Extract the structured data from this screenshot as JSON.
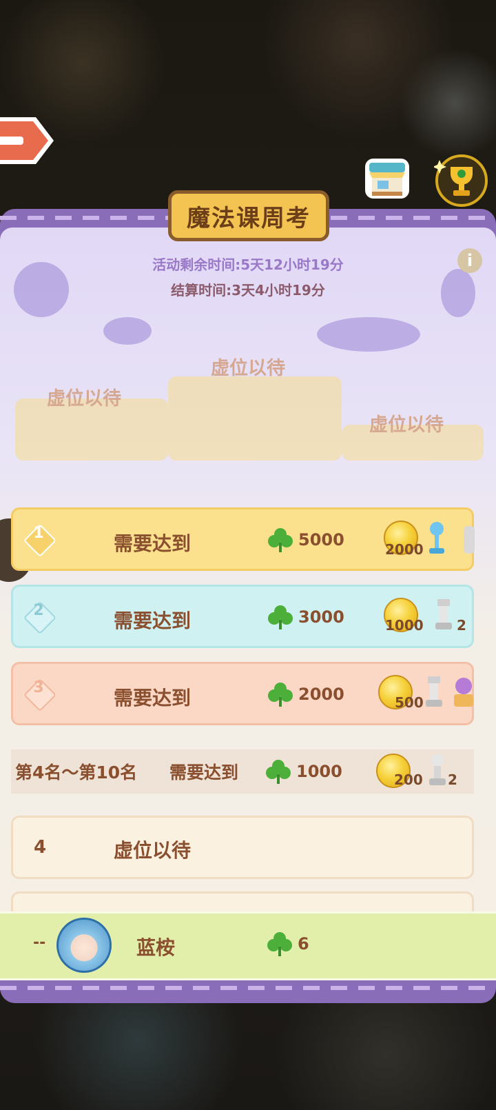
{
  "header": {
    "title": "魔法课周考",
    "remaining_time": "活动剩余时间:5天12小时19分",
    "settlement_time": "结算时间:3天4小时19分"
  },
  "icons": {
    "back": "back-arrow-icon",
    "shop": "shop-stall-icon",
    "trophy": "trophy-icon",
    "info": "info-icon",
    "clover": "clover-icon",
    "coin": "coin-icon"
  },
  "podium": {
    "first": "虚位以待",
    "second": "虚位以待",
    "third": "虚位以待"
  },
  "rewards": [
    {
      "rank": "1",
      "label": "需要达到",
      "score": "5000",
      "coins": "2000",
      "extra_count": ""
    },
    {
      "rank": "2",
      "label": "需要达到",
      "score": "3000",
      "coins": "1000",
      "extra_count": "2"
    },
    {
      "rank": "3",
      "label": "需要达到",
      "score": "2000",
      "coins": "500",
      "extra_count": ""
    }
  ],
  "tier": {
    "range": "第4名～第10名",
    "label": "需要达到",
    "score": "1000",
    "coins": "200",
    "extra_count": "2"
  },
  "leaderboard": [
    {
      "rank": "4",
      "name": "虚位以待"
    }
  ],
  "self": {
    "rank": "--",
    "name": "蓝桉",
    "score": "6"
  },
  "colors": {
    "panel_border": "#8a6db8",
    "gold_row": "#fbe08d",
    "blue_row": "#cff1f1",
    "pink_row": "#fbd8c6",
    "self_row": "#e2efab",
    "text_brown": "#8a4f2e"
  }
}
